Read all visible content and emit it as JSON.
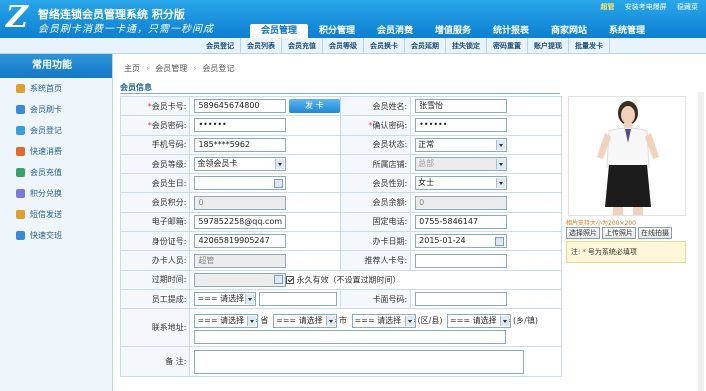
{
  "header": {
    "logo_letter": "Z",
    "title": "智络连锁会员管理系统 积分版",
    "slogan": "会员刷卡消费一卡通，只需一秒间成",
    "user_label": "超管",
    "links": [
      "安装考电爆屏",
      "稳藏菜"
    ],
    "tabs": [
      "会员管理",
      "积分管理",
      "会员消费",
      "增值服务",
      "统计报表",
      "商家网站",
      "系统管理"
    ]
  },
  "subnav": [
    "会员登记",
    "会员列表",
    "会员充值",
    "会员等级",
    "会员换卡",
    "会员延期",
    "挂失锁定",
    "密码重置",
    "账户提现",
    "批量发卡"
  ],
  "sidebar": {
    "title": "常用功能",
    "items": [
      {
        "label": "系统首页",
        "color": "#e0a030"
      },
      {
        "label": "会员刷卡",
        "color": "#3a8ad8"
      },
      {
        "label": "会员登记",
        "color": "#3aa0d8"
      },
      {
        "label": "快速消费",
        "color": "#e06b2a"
      },
      {
        "label": "会员充值",
        "color": "#3aa06a"
      },
      {
        "label": "积分兑换",
        "color": "#7a7ad8"
      },
      {
        "label": "短信发送",
        "color": "#e0a030"
      },
      {
        "label": "快速交班",
        "color": "#3a8ad8"
      }
    ]
  },
  "breadcrumb": [
    "主页",
    "会员管理",
    "会员登记"
  ],
  "section_title": "会员信息",
  "form": {
    "card_no_label": "会员卡号:",
    "card_no": "589645674800",
    "issue_btn": "发 卡",
    "name_label": "会员姓名:",
    "name": "张雪怡",
    "pwd_label": "会员密码:",
    "pwd": "••••••",
    "pwd2_label": "确认密码:",
    "pwd2": "••••••",
    "phone_label": "手机号码:",
    "phone": "185****5962",
    "status_label": "会员状态:",
    "status": "正常",
    "level_label": "会员等级:",
    "level": "金领会员卡",
    "store_label": "所属店铺:",
    "store": "总部",
    "birthday_label": "会员生日:",
    "birthday": "",
    "gender_label": "会员性别:",
    "gender": "女士",
    "points_label": "会员积分:",
    "points": "0",
    "balance_label": "会员余额:",
    "balance": "0",
    "email_label": "电子邮箱:",
    "email": "597852258@qq.com",
    "tel_label": "固定电话:",
    "tel": "0755-5846147",
    "idcard_label": "身份证号:",
    "idcard": "42065819905247",
    "issue_date_label": "办卡日期:",
    "issue_date": "2015-01-24",
    "operator_label": "办卡人员:",
    "operator": "超管",
    "referrer_label": "推荐人卡号:",
    "referrer": "",
    "expire_label": "过期时间:",
    "expire": "",
    "permanent_label": "永久有效（不设置过期时间）",
    "staff_label": "员工提成:",
    "staff_select": "=== 请选择 ===",
    "cardface_label": "卡面号码:",
    "cardface": "",
    "address_label": "联系地址:",
    "province": "=== 请选择 ===",
    "province_unit": "省",
    "city": "=== 请选择 ===",
    "city_unit": "市",
    "district": "=== 请选择 ===",
    "district_unit": "(区/县)",
    "town": "=== 请选择 ===",
    "town_unit": "(乡/镇)",
    "remark_label": "备 注:"
  },
  "photo": {
    "hint": "相片支持大小为200×200",
    "buttons": [
      "选择照片",
      "上传照片",
      "在线拍摄"
    ],
    "note_prefix": "注:",
    "note_dot": "*",
    "note_text": "号为系统必填项"
  },
  "colors": {
    "header_blue": "#1a8fdf",
    "accent": "#0d72c0",
    "required": "#ee3333"
  }
}
